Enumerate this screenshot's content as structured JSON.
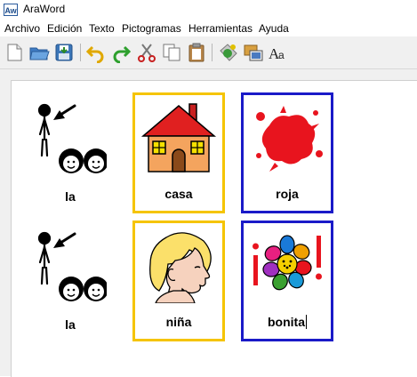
{
  "window": {
    "title": "AraWord",
    "icon_text": "Aw"
  },
  "menu": [
    "Archivo",
    "Edición",
    "Texto",
    "Pictogramas",
    "Herramientas",
    "Ayuda"
  ],
  "toolbar": {
    "icons": [
      "new-document-icon",
      "open-folder-icon",
      "save-icon",
      "undo-icon",
      "redo-icon",
      "cut-icon",
      "copy-icon",
      "paste-icon",
      "pictogram-settings-icon",
      "image-swap-icon",
      "font-icon"
    ]
  },
  "colors": {
    "frame_yellow": "#f5c400",
    "frame_blue": "#1a1ac8"
  },
  "cells": [
    {
      "label": "la",
      "frame": "none"
    },
    {
      "label": "casa",
      "frame": "yellow"
    },
    {
      "label": "roja",
      "frame": "blue"
    },
    {
      "label": "la",
      "frame": "none"
    },
    {
      "label": "niña",
      "frame": "yellow"
    },
    {
      "label": "bonita",
      "frame": "blue"
    }
  ]
}
